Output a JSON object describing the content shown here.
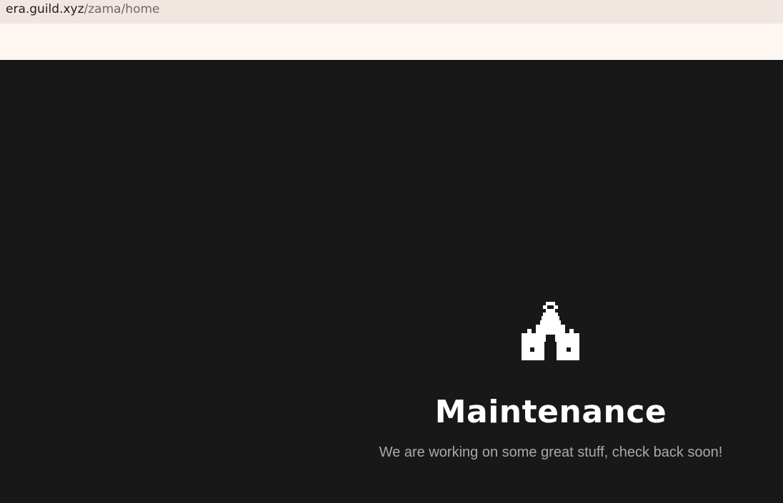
{
  "browser": {
    "url_domain": "era.guild.xyz",
    "url_path": "/zama/home"
  },
  "maintenance": {
    "icon": "castle-icon",
    "title": "Maintenance",
    "message": "We are working on some great stuff, check back soon!"
  },
  "colors": {
    "background": "#181818",
    "url_bar": "#f2e6e1",
    "toolbar": "#fdf6f1",
    "title": "#ffffff",
    "message": "#a9a9a9"
  }
}
